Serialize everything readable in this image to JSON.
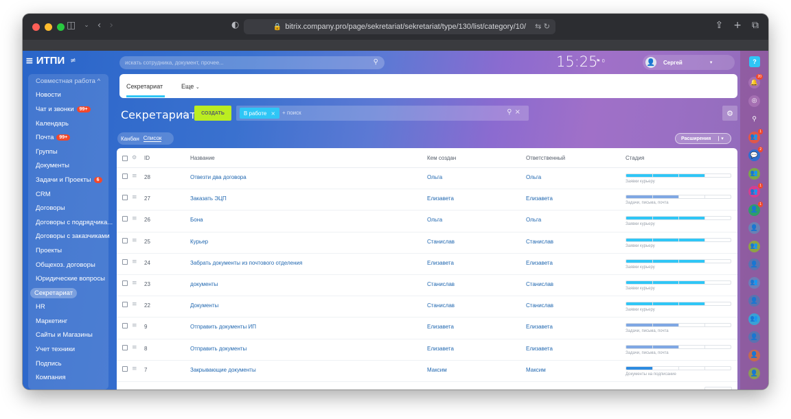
{
  "browser": {
    "url": "bitrix.company.pro/page/sekretariat/sekretariat/type/130/list/category/10/",
    "lock_icon": "lock-icon",
    "traffic_lights": [
      "#fe5f57",
      "#febc2e",
      "#28c840"
    ]
  },
  "app": {
    "logo": "ИТПИ",
    "search_placeholder": "искать сотрудника, документ, прочее...",
    "time": "15:25",
    "flag_count": "0",
    "user_name": "Сергей"
  },
  "sidebar": {
    "group": "Совместная работа ^",
    "items": [
      {
        "label": "Новости",
        "badge": ""
      },
      {
        "label": "Чат и звонки",
        "badge": "99+"
      },
      {
        "label": "Календарь",
        "badge": ""
      },
      {
        "label": "Почта",
        "badge": "99+"
      },
      {
        "label": "Группы",
        "badge": ""
      },
      {
        "label": "Документы",
        "badge": ""
      },
      {
        "label": "Задачи и Проекты",
        "badge": "6"
      },
      {
        "label": "CRM",
        "badge": ""
      },
      {
        "label": "Договоры",
        "badge": ""
      },
      {
        "label": "Договоры с подрядчика...",
        "badge": ""
      },
      {
        "label": "Договоры с заказчиками",
        "badge": ""
      },
      {
        "label": "Проекты",
        "badge": ""
      },
      {
        "label": "Общехоз. договоры",
        "badge": ""
      },
      {
        "label": "Юридические вопросы",
        "badge": ""
      },
      {
        "label": "Секретариат",
        "badge": "",
        "active": true
      },
      {
        "label": "HR",
        "badge": ""
      },
      {
        "label": "Маркетинг",
        "badge": ""
      },
      {
        "label": "Сайты и Магазины",
        "badge": ""
      },
      {
        "label": "Учет техники",
        "badge": ""
      },
      {
        "label": "Подпись",
        "badge": ""
      },
      {
        "label": "Компания",
        "badge": ""
      }
    ]
  },
  "tabs": {
    "active": "Секретариат",
    "more": "Еще"
  },
  "toolbar": {
    "title": "Секретариат",
    "create": "СОЗДАТЬ",
    "filter_chip": "В работе",
    "filter_add": "+ поиск"
  },
  "view": {
    "kanban": "Канбан",
    "list": "Список",
    "extensions": "Расширения"
  },
  "grid": {
    "headers": {
      "id": "ID",
      "name": "Название",
      "created_by": "Кем создан",
      "responsible": "Ответственный",
      "stage": "Стадия"
    },
    "rows": [
      {
        "id": "28",
        "name": "Отвезти два договора",
        "created_by": "Ольга",
        "responsible": "Ольга",
        "stage": "Заявки курьеру",
        "progress": 0.75,
        "color": "#2fc6f6"
      },
      {
        "id": "27",
        "name": "Заказать ЭЦП",
        "created_by": "Елизавета",
        "responsible": "Елизавета",
        "stage": "Задачи, письма, почта",
        "progress": 0.5,
        "color": "#7fa7e3"
      },
      {
        "id": "26",
        "name": "Бона",
        "created_by": "Ольга",
        "responsible": "Ольга",
        "stage": "Заявки курьеру",
        "progress": 0.75,
        "color": "#2fc6f6"
      },
      {
        "id": "25",
        "name": "Курьер",
        "created_by": "Станислав",
        "responsible": "Станислав",
        "stage": "Заявки курьеру",
        "progress": 0.75,
        "color": "#2fc6f6"
      },
      {
        "id": "24",
        "name": "Забрать документы из почтового отделения",
        "created_by": "Елизавета",
        "responsible": "Елизавета",
        "stage": "Заявки курьеру",
        "progress": 0.75,
        "color": "#2fc6f6"
      },
      {
        "id": "23",
        "name": "документы",
        "created_by": "Станислав",
        "responsible": "Станислав",
        "stage": "Заявки курьеру",
        "progress": 0.75,
        "color": "#2fc6f6"
      },
      {
        "id": "22",
        "name": "Документы",
        "created_by": "Станислав",
        "responsible": "Станислав",
        "stage": "Заявки курьеру",
        "progress": 0.75,
        "color": "#2fc6f6"
      },
      {
        "id": "9",
        "name": "Отправить документы ИП",
        "created_by": "Елизавета",
        "responsible": "Елизавета",
        "stage": "Задачи, письма, почта",
        "progress": 0.5,
        "color": "#7fa7e3"
      },
      {
        "id": "8",
        "name": "Отправить документы",
        "created_by": "Елизавета",
        "responsible": "Елизавета",
        "stage": "Задачи, письма, почта",
        "progress": 0.5,
        "color": "#7fa7e3"
      },
      {
        "id": "7",
        "name": "Закрывающие документы",
        "created_by": "Максим",
        "responsible": "Максим",
        "stage": "Документы на подписание",
        "progress": 0.25,
        "color": "#2d8be0"
      }
    ]
  },
  "rightbar": {
    "help": "?",
    "items": [
      {
        "icon": "bell-icon",
        "color": "#a56fb2",
        "count": "20"
      },
      {
        "icon": "chat-icon",
        "color": "#a56fb2",
        "count": ""
      },
      {
        "icon": "search-icon",
        "color": "transparent",
        "count": ""
      },
      {
        "icon": "user-group-icon",
        "color": "#e0574a",
        "count": "1"
      },
      {
        "icon": "chat-group-icon",
        "color": "#2f6fcf",
        "count": "2"
      },
      {
        "icon": "user-group-icon",
        "color": "#7aa84a",
        "count": ""
      },
      {
        "icon": "user-group-icon",
        "color": "#d43f91",
        "count": "1"
      },
      {
        "icon": "user-icon",
        "color": "#2e9e6a",
        "count": "1"
      },
      {
        "icon": "user-icon",
        "color": "#6a82b4",
        "count": ""
      },
      {
        "icon": "user-group-icon",
        "color": "#8ea346",
        "count": ""
      },
      {
        "icon": "user-icon",
        "color": "#5a73b0",
        "count": ""
      },
      {
        "icon": "user-group-icon",
        "color": "#6c7fb8",
        "count": ""
      },
      {
        "icon": "user-icon",
        "color": "#5a73b0",
        "count": ""
      },
      {
        "icon": "user-group-icon",
        "color": "#3aa1d4",
        "count": ""
      },
      {
        "icon": "user-icon",
        "color": "#5a73b0",
        "count": ""
      },
      {
        "icon": "user-icon",
        "color": "#c46a50",
        "count": ""
      },
      {
        "icon": "user-icon",
        "color": "#8a9e55",
        "count": ""
      }
    ]
  }
}
